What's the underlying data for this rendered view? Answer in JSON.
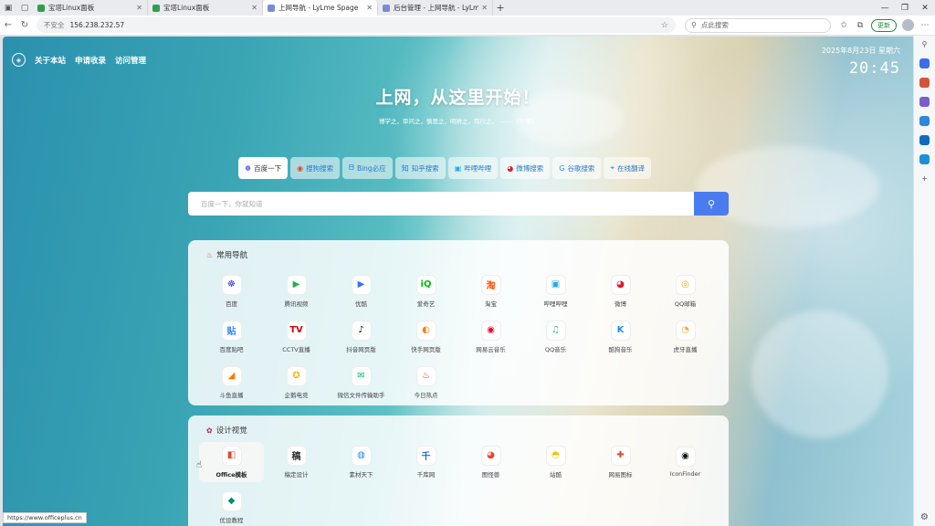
{
  "browser": {
    "tabs": [
      {
        "title": "宝塔Linux面板",
        "color": "#2e9f4a"
      },
      {
        "title": "宝塔Linux面板",
        "color": "#2e9f4a"
      },
      {
        "title": "上网导航 - LyLme Spage",
        "color": "#7a8bd6",
        "active": true
      },
      {
        "title": "后台管理 - 上网导航 - LyLme Spa...",
        "color": "#7a8bd6"
      }
    ],
    "security_label": "不安全",
    "url": "156.238.232.57",
    "search_placeholder": "点此搜索",
    "update_label": "更新"
  },
  "nav": {
    "items": [
      "关于本站",
      "申请收录",
      "访问管理"
    ]
  },
  "clock": {
    "date": "2025年8月23日 星期六",
    "time": "20:45"
  },
  "hero": {
    "title": "上网，从这里开始！",
    "subtitle": "博学之，审问之，慎思之，明辨之，笃行之。 —— 《中庸》"
  },
  "engines": [
    {
      "label": "百度一下",
      "icon": "☸",
      "color": "#2932e1"
    },
    {
      "label": "搜狗搜索",
      "icon": "◉",
      "color": "#e0492b"
    },
    {
      "label": "Bing必应",
      "icon": "ᗷ",
      "color": "#0f7dd6"
    },
    {
      "label": "知乎搜索",
      "icon": "知",
      "color": "#1677ff"
    },
    {
      "label": "哔哩哔哩",
      "icon": "▣",
      "color": "#23ade5"
    },
    {
      "label": "微博搜索",
      "icon": "◕",
      "color": "#e6162d"
    },
    {
      "label": "谷歌搜索",
      "icon": "G",
      "color": "#4285f4"
    },
    {
      "label": "在线翻译",
      "icon": "⌖",
      "color": "#2d79c7"
    }
  ],
  "search": {
    "placeholder": "百度一下，你就知道"
  },
  "sections": [
    {
      "title": "常用导航",
      "icon": "♨",
      "sites": [
        {
          "label": "百度",
          "icon": "☸",
          "color": "#2932e1"
        },
        {
          "label": "腾讯视频",
          "icon": "▶",
          "color": "#20b14a"
        },
        {
          "label": "优酷",
          "icon": "▶",
          "color": "#3b6ff5"
        },
        {
          "label": "爱奇艺",
          "icon": "iQ",
          "color": "#00be06"
        },
        {
          "label": "淘宝",
          "icon": "淘",
          "color": "#ff5000"
        },
        {
          "label": "哔哩哔哩",
          "icon": "▣",
          "color": "#23ade5"
        },
        {
          "label": "微博",
          "icon": "◕",
          "color": "#e6162d"
        },
        {
          "label": "QQ邮箱",
          "icon": "◎",
          "color": "#f0a30a"
        },
        {
          "label": "百度贴吧",
          "icon": "贴",
          "color": "#3385ff"
        },
        {
          "label": "CCTV直播",
          "icon": "TV",
          "color": "#d7000f"
        },
        {
          "label": "抖音网页版",
          "icon": "♪",
          "color": "#111111"
        },
        {
          "label": "快手网页版",
          "icon": "◐",
          "color": "#ff7e00"
        },
        {
          "label": "网易云音乐",
          "icon": "◉",
          "color": "#e60026"
        },
        {
          "label": "QQ音乐",
          "icon": "♫",
          "color": "#31c27c"
        },
        {
          "label": "酷狗音乐",
          "icon": "K",
          "color": "#1b8fe8"
        },
        {
          "label": "虎牙直播",
          "icon": "◔",
          "color": "#f5a623"
        },
        {
          "label": "斗鱼直播",
          "icon": "◢",
          "color": "#ff7700"
        },
        {
          "label": "企鹅电竞",
          "icon": "✪",
          "color": "#f5b400"
        },
        {
          "label": "微信文件传输助手",
          "icon": "✉",
          "color": "#07c160"
        },
        {
          "label": "今日热点",
          "icon": "♨",
          "color": "#f0262c"
        }
      ]
    },
    {
      "title": "设计视觉",
      "icon": "✿",
      "sites": [
        {
          "label": "Office模板",
          "icon": "◧",
          "color": "#e0492b",
          "hover": true
        },
        {
          "label": "稿定设计",
          "icon": "稿",
          "color": "#333333"
        },
        {
          "label": "素材天下",
          "icon": "◍",
          "color": "#1b8fe8"
        },
        {
          "label": "千库网",
          "icon": "千",
          "color": "#1c6dd0"
        },
        {
          "label": "图怪兽",
          "icon": "◕",
          "color": "#e0492b"
        },
        {
          "label": "站酷",
          "icon": "◓",
          "color": "#f5c400"
        },
        {
          "label": "网易图标",
          "icon": "✚",
          "color": "#e0492b"
        },
        {
          "label": "IconFinder",
          "icon": "◉",
          "color": "#111111"
        },
        {
          "label": "优设教程",
          "icon": "◆",
          "color": "#0a8a6e"
        }
      ]
    }
  ],
  "status_url": "https://www.officeplus.cn"
}
